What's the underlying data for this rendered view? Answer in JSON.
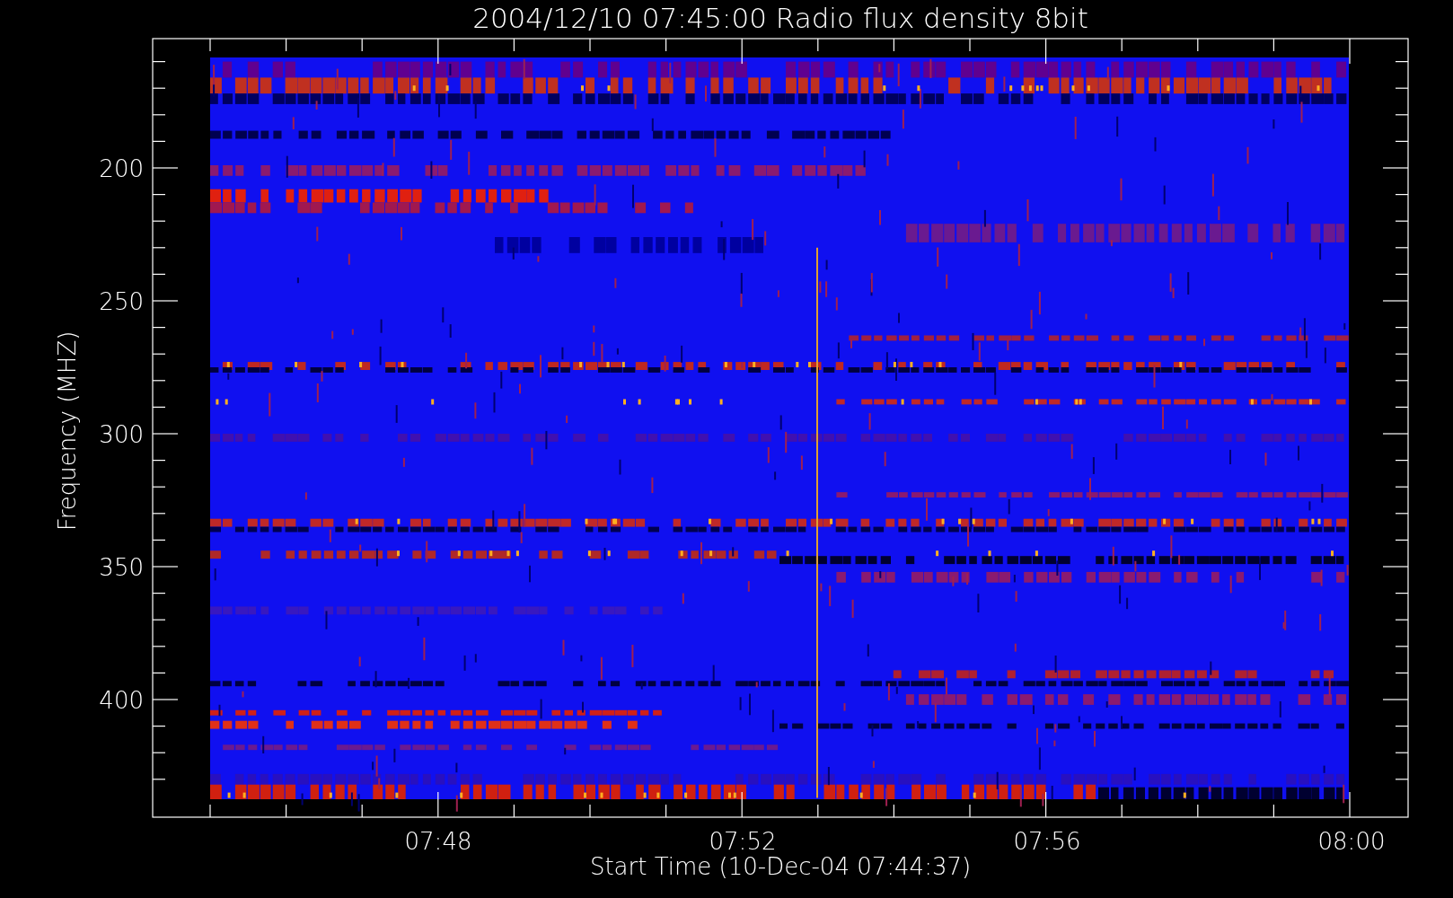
{
  "plot": {
    "title": "2004/12/10 07:45:00 Radio flux density 8bit",
    "y_axis": {
      "label": "Frequency (MHZ)",
      "tick_labels": [
        "200",
        "250",
        "300",
        "350",
        "400"
      ]
    },
    "x_axis": {
      "label": "Start Time (10-Dec-04 07:44:37)",
      "tick_labels": [
        "07:48",
        "07:52",
        "07:56",
        "08:00"
      ]
    }
  }
}
